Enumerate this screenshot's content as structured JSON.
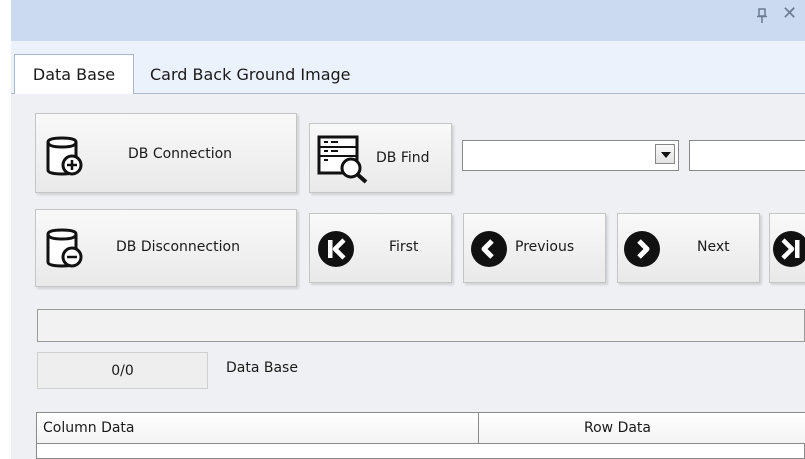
{
  "window": {
    "pin_icon": "pin-icon",
    "close_icon": "close-icon",
    "close_glyph": "✕"
  },
  "tabs": [
    {
      "label": "Data Base",
      "active": true
    },
    {
      "label": "Card Back Ground Image",
      "active": false
    }
  ],
  "toolbar": {
    "db_connection": {
      "label": "DB Connection",
      "icon": "database-add-icon"
    },
    "db_disconnection": {
      "label": "DB Disconnection",
      "icon": "database-remove-icon"
    },
    "db_find": {
      "label": "DB Find",
      "icon": "database-search-icon"
    },
    "find_field_combo": {
      "value": ""
    },
    "find_value_field": {
      "value": ""
    },
    "first": {
      "label": "First",
      "icon": "first-icon"
    },
    "previous": {
      "label": "Previous",
      "icon": "previous-icon"
    },
    "next": {
      "label": "Next",
      "icon": "next-icon"
    },
    "last": {
      "label": "",
      "icon": "last-icon"
    }
  },
  "status": {
    "progress": 0,
    "record_counter": "0/0",
    "source_label": "Data Base"
  },
  "grid": {
    "columns": [
      "Column Data",
      "Row Data"
    ],
    "rows": []
  },
  "colors": {
    "titlebar": "#cbdaf0",
    "tabstrip": "#ecf2fb",
    "panel": "#eef0f3"
  }
}
